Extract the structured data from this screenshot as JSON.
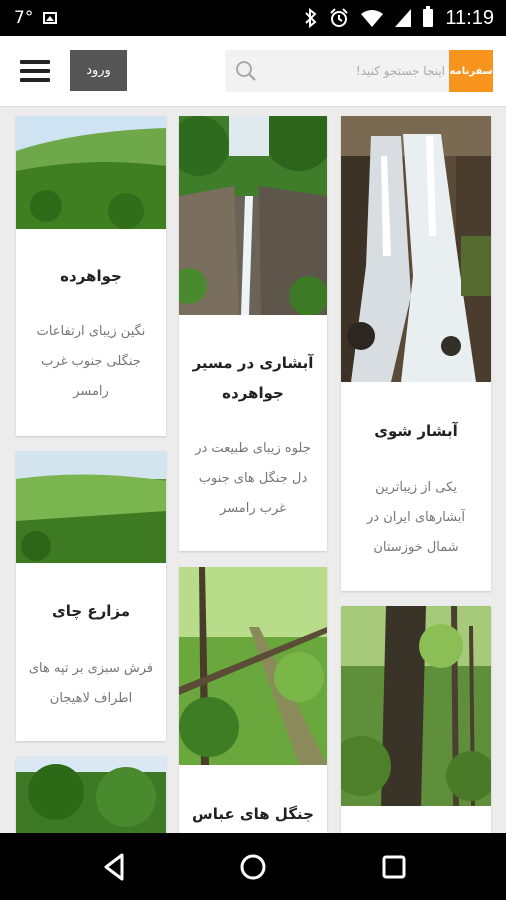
{
  "status_bar": {
    "notification": "7°",
    "time": "11:19",
    "icons": [
      "image-icon",
      "bluetooth-icon",
      "alarm-icon",
      "wifi-icon",
      "signal-icon",
      "battery-icon"
    ]
  },
  "header": {
    "menu_icon": "hamburger-menu-icon",
    "login_label": "ورود",
    "search_placeholder": "اینجا جستجو کنید!",
    "search_icon": "search-icon",
    "brand_text": "سفرنامه",
    "brand_color": "#f7941d"
  },
  "cards": [
    {
      "title": "آبشار شوی",
      "description": "یکی از زیباترین آبشارهای ایران در شمال خوزستان",
      "image": "waterfall-photo"
    },
    {
      "title": "آبشاری در مسیر جواهرده",
      "description": "جلوه زیبای طبیعت در دل جنگل های جنوب غرب رامسر",
      "image": "waterfall-canyon-photo"
    },
    {
      "title": "جواهرده",
      "description": "نگین زیبای ارتفاعات جنگلی جنوب غرب رامسر",
      "image": "green-hills-photo"
    },
    {
      "title": "مزارع چای",
      "description": "فرش سبزی بر تپه های اطراف لاهیجان",
      "image": "tea-fields-photo"
    },
    {
      "title": "جنگل های عباس",
      "description": "",
      "image": "forest-photo"
    },
    {
      "title": "",
      "description": "",
      "image": "tall-tree-photo"
    },
    {
      "title": "",
      "description": "",
      "image": "forest-path-photo"
    }
  ],
  "nav_bar": {
    "icons": [
      "back-icon",
      "home-icon",
      "recents-icon"
    ]
  }
}
